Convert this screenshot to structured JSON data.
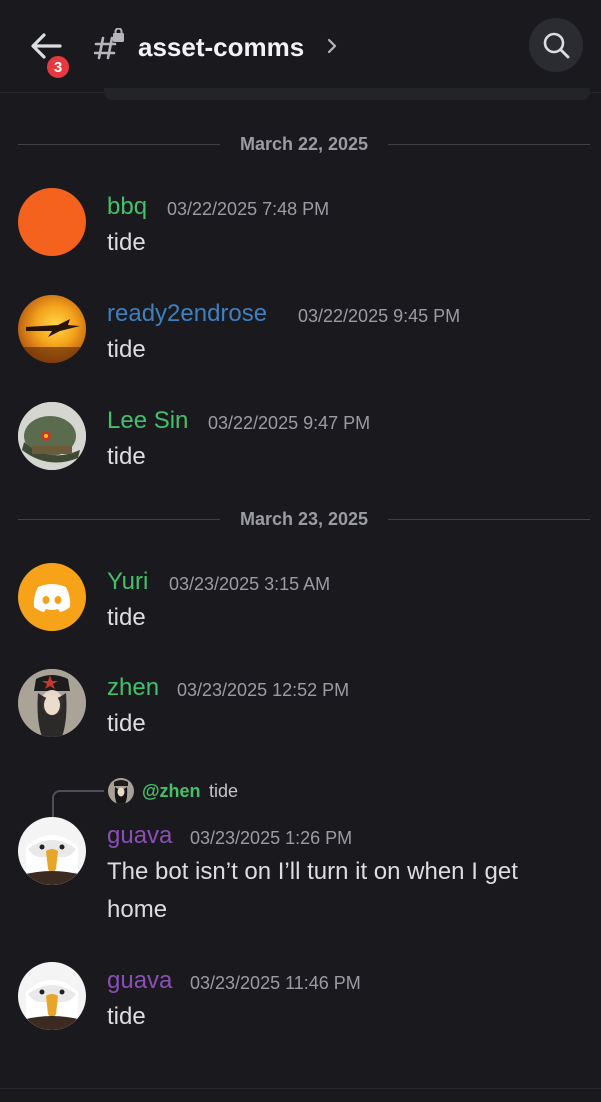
{
  "header": {
    "notification_count": "3",
    "channel_name": "asset-comms"
  },
  "date_separators": [
    "March 22, 2025",
    "March 23, 2025"
  ],
  "messages": [
    {
      "author": "bbq",
      "author_color": "#43c06b",
      "timestamp": "03/22/2025 7:48 PM",
      "text": "tide"
    },
    {
      "author": "ready2endrose",
      "author_color": "#3e7fc0",
      "timestamp": "03/22/2025 9:45 PM",
      "text": "tide"
    },
    {
      "author": "Lee Sin",
      "author_color": "#43c06b",
      "timestamp": "03/22/2025 9:47 PM",
      "text": "tide"
    },
    {
      "author": "Yuri",
      "author_color": "#43c06b",
      "timestamp": "03/23/2025 3:15 AM",
      "text": "tide"
    },
    {
      "author": "zhen",
      "author_color": "#43c06b",
      "timestamp": "03/23/2025 12:52 PM",
      "text": "tide"
    },
    {
      "author": "guava",
      "author_color": "#8a4fb5",
      "timestamp": "03/23/2025 1:26 PM",
      "text": "The bot isn’t on I’ll turn it on when I get home"
    },
    {
      "author": "guava",
      "author_color": "#8a4fb5",
      "timestamp": "03/23/2025 11:46 PM",
      "text": "tide"
    }
  ],
  "reply": {
    "mention": "@zhen",
    "text": "tide"
  },
  "colors": {
    "background": "#1a1a1e",
    "green_role": "#43c06b",
    "blue_role": "#3e7fc0",
    "purple_role": "#8a4fb5",
    "badge": "#e5393f"
  }
}
